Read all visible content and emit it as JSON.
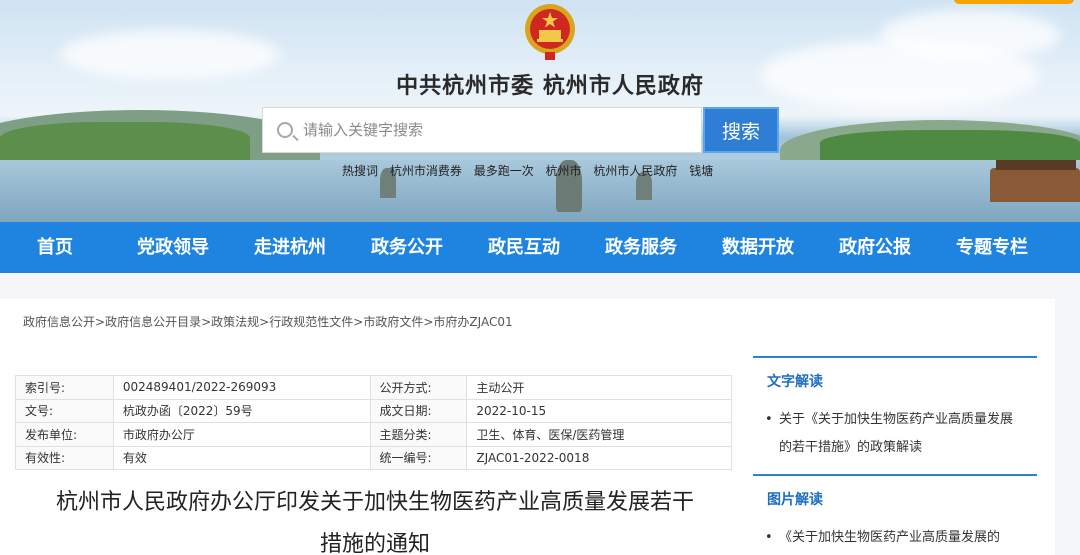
{
  "header": {
    "site_title": "中共杭州市委   杭州市人民政府",
    "emblem_icon": "national-emblem-icon"
  },
  "search": {
    "placeholder": "请输入关键字搜索",
    "button_label": "搜索",
    "hot_words": [
      "热搜词",
      "杭州市消费券",
      "最多跑一次",
      "杭州市",
      "杭州市人民政府",
      "钱塘"
    ]
  },
  "nav": {
    "items": [
      "首页",
      "党政领导",
      "走进杭州",
      "政务公开",
      "政民互动",
      "政务服务",
      "数据开放",
      "政府公报",
      "专题专栏"
    ]
  },
  "breadcrumb": [
    "政府信息公开",
    "政府信息公开目录",
    "政策法规",
    "行政规范性文件",
    "市政府文件",
    "市府办ZJAC01"
  ],
  "breadcrumb_separator": ">",
  "info": {
    "rows": [
      {
        "label1": "索引号:",
        "value1": "002489401/2022-269093",
        "label2": "公开方式:",
        "value2": "主动公开"
      },
      {
        "label1": "文号:",
        "value1": "杭政办函〔2022〕59号",
        "label2": "成文日期:",
        "value2": "2022-10-15"
      },
      {
        "label1": "发布单位:",
        "value1": "市政府办公厅",
        "label2": "主题分类:",
        "value2": "卫生、体育、医保/医药管理"
      },
      {
        "label1": "有效性:",
        "value1": "有效",
        "label2": "统一编号:",
        "value2": "ZJAC01-2022-0018"
      }
    ]
  },
  "document": {
    "title_line1": "杭州市人民政府办公厅印发关于加快生物医药产业高质量发展若干",
    "title_line2": "措施的通知"
  },
  "sidebar": {
    "text_reading": {
      "heading": "文字解读",
      "items": [
        "关于《关于加快生物医药产业高质量发展的若干措施》的政策解读"
      ]
    },
    "image_reading": {
      "heading": "图片解读",
      "items": [
        "《关于加快生物医药产业高质量发展的"
      ]
    }
  },
  "colors": {
    "nav_bg": "#1e84e0",
    "search_button": "#2e7ed6",
    "side_heading": "#1e6fbf",
    "top_tab": "#f7a400"
  }
}
